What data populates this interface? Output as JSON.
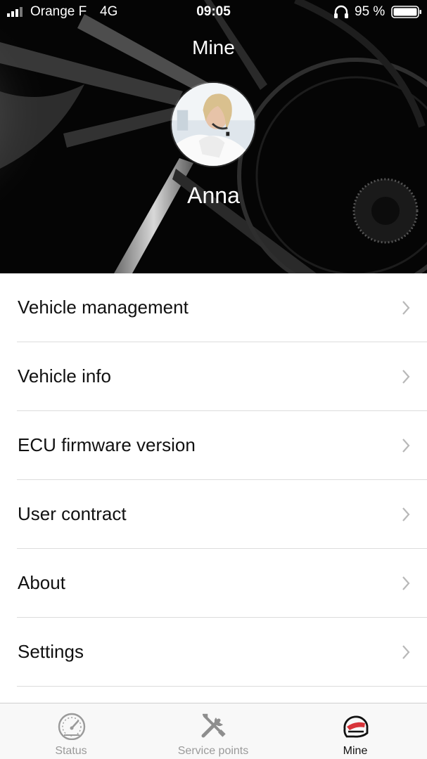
{
  "status_bar": {
    "carrier": "Orange F",
    "network": "4G",
    "time": "09:05",
    "battery_percent": "95 %"
  },
  "header": {
    "title": "Mine",
    "username": "Anna"
  },
  "menu": {
    "items": [
      {
        "label": "Vehicle management"
      },
      {
        "label": "Vehicle info"
      },
      {
        "label": "ECU firmware version"
      },
      {
        "label": "User contract"
      },
      {
        "label": "About"
      },
      {
        "label": "Settings"
      }
    ]
  },
  "tabbar": {
    "tabs": [
      {
        "label": "Status",
        "icon": "speedometer-icon",
        "active": false
      },
      {
        "label": "Service points",
        "icon": "wrench-screwdriver-icon",
        "active": false
      },
      {
        "label": "Mine",
        "icon": "helmet-icon",
        "active": true
      }
    ]
  },
  "colors": {
    "accent_red": "#d8343a",
    "inactive_tab": "#9a9a9a",
    "active_tab": "#111111",
    "header_bg": "#060606"
  }
}
